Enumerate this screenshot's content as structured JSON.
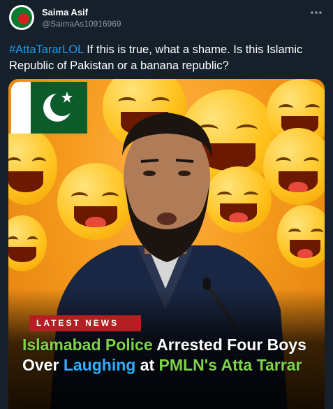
{
  "author": {
    "name": "Saima Asif",
    "handle": "@SaimaAs10916969"
  },
  "tweet": {
    "hashtag": "#AttaTararLOL",
    "text": " If this is true, what a shame. Is this Islamic Republic of Pakistan or a banana republic?"
  },
  "media": {
    "banner_label": "LATEST NEWS",
    "headline": {
      "part1": "Islamabad Police",
      "part2": " Arrested Four Boys Over ",
      "part3": "Laughing",
      "part4": " at ",
      "part5": "PMLN's Atta Tarrar"
    }
  },
  "icons": [
    "more-options-icon",
    "pakistan-flag-icon",
    "laughing-emoji-icon"
  ],
  "colors": {
    "background": "#15202b",
    "hashtag": "#1d9bf0",
    "handle": "#8899a6",
    "banner": "#b51f24",
    "headline_green": "#7fd34b",
    "headline_blue": "#2fb0ff"
  }
}
